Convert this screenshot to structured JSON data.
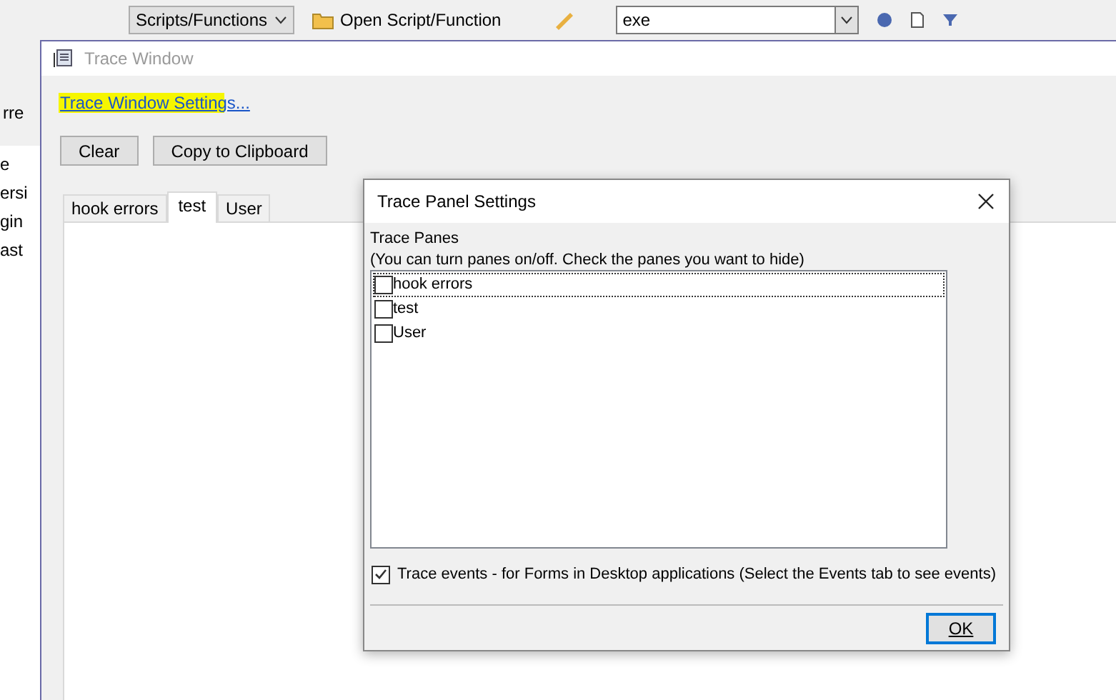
{
  "background_app": {
    "toolbar": {
      "dropdown": "Scripts/Functions",
      "open_button": "Open Script/Function",
      "search_value": "exe"
    },
    "sidebar_fragments": [
      "rre",
      "e",
      "ersi",
      "gin",
      "ast"
    ]
  },
  "trace_window": {
    "title": "Trace Window",
    "settings_link": "Trace Window Settings...",
    "buttons": [
      "Clear",
      "Copy to Clipboard"
    ],
    "tabs": [
      {
        "label": "hook errors",
        "selected": false
      },
      {
        "label": "test",
        "selected": true
      },
      {
        "label": "User",
        "selected": false
      }
    ]
  },
  "dialog": {
    "title": "Trace Panel Settings",
    "section_label": "Trace Panes",
    "hint": "(You can turn panes on/off. Check the panes you want to hide)",
    "panes": [
      {
        "label": "hook errors",
        "checked": false,
        "focused": true
      },
      {
        "label": "test",
        "checked": false,
        "focused": false
      },
      {
        "label": "User",
        "checked": false,
        "focused": false
      }
    ],
    "trace_events": {
      "label": "Trace events - for Forms in Desktop applications (Select the Events tab to see events)",
      "checked": true
    },
    "ok_button": "OK"
  }
}
